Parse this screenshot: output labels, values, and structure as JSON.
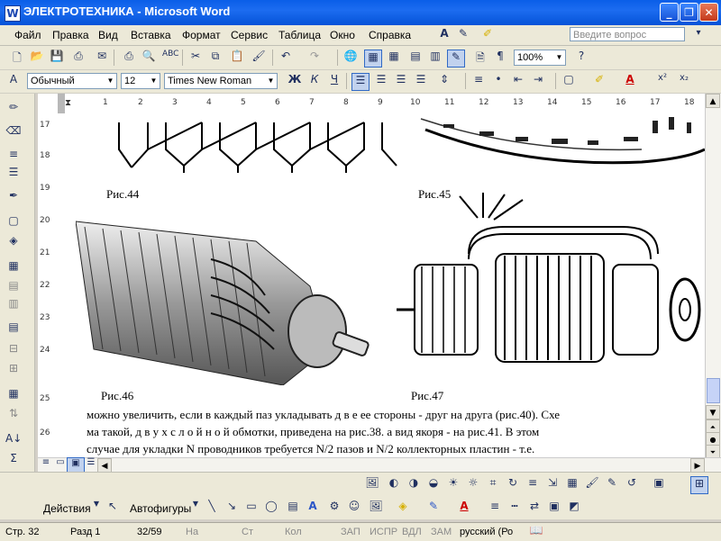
{
  "window": {
    "title": "ЭЛЕКТРОТЕХНИКА - Microsoft Word",
    "app_icon": "W"
  },
  "menu": {
    "items": [
      "Файл",
      "Правка",
      "Вид",
      "Вставка",
      "Формат",
      "Сервис",
      "Таблица",
      "Окно",
      "Справка"
    ],
    "help_placeholder": "Введите вопрос"
  },
  "standard_toolbar": {
    "zoom": "100%"
  },
  "formatting_toolbar": {
    "style": "Обычный",
    "size": "12",
    "font": "Times New Roman",
    "bold": "Ж",
    "italic": "К",
    "underline": "Ч"
  },
  "ruler": {
    "h_ticks": [
      "1",
      "2",
      "3",
      "4",
      "5",
      "6",
      "7",
      "8",
      "9",
      "10",
      "11",
      "12",
      "13",
      "14",
      "15",
      "16",
      "17",
      "18"
    ],
    "v_ticks": [
      "17",
      "18",
      "19",
      "20",
      "21",
      "22",
      "23",
      "24",
      "25",
      "26"
    ]
  },
  "document": {
    "captions": {
      "fig44": "Рис.44",
      "fig45": "Рис.45",
      "fig46": "Рис.46",
      "fig47": "Рис.47"
    },
    "paragraph": [
      "можно увеличить, если в каждый паз укладывать д в е ее стороны - друг на друга (рис.40). Схе",
      "ма такой, д в у х с л о й н о й обмотки, приведена на рис.38. а вид якоря - на рис.41. В этом",
      "случае для укладки N проводников требуется N/2 пазов и N/2 коллекторных пластин - т.е."
    ]
  },
  "drawing_toolbar": {
    "actions": "Действия",
    "autoshapes": "Автофигуры"
  },
  "status": {
    "page": "Стр. 32",
    "section": "Разд 1",
    "pages": "32/59",
    "at": "На",
    "line": "Ст",
    "col": "Кол",
    "rec": "ЗАП",
    "trk": "ИСПР",
    "ext": "ВДЛ",
    "ovr": "ЗАМ",
    "lang": "русский (Ро"
  }
}
